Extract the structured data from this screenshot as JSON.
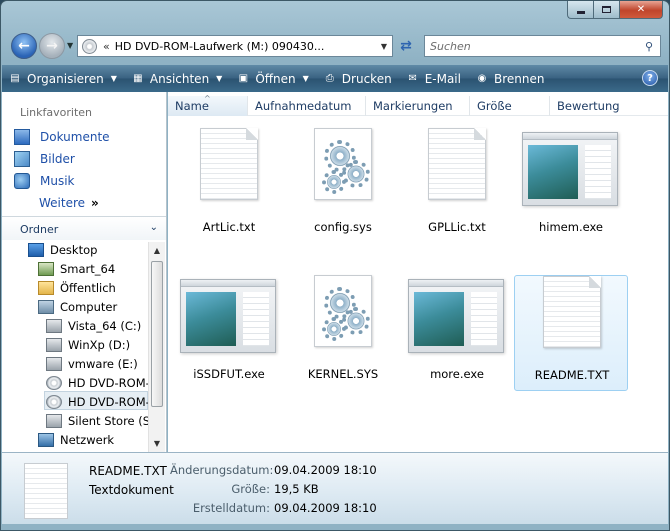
{
  "window": {
    "caption": {
      "minimize": "",
      "maximize": "",
      "close": "✕"
    }
  },
  "nav": {
    "address_path": "HD DVD-ROM-Laufwerk (M:) 090430...",
    "address_chevron": "«",
    "search_placeholder": "Suchen"
  },
  "commands": [
    {
      "label": "Organisieren",
      "icon": "organize-icon",
      "has_dropdown": true
    },
    {
      "label": "Ansichten",
      "icon": "views-icon",
      "has_dropdown": true
    },
    {
      "label": "Öffnen",
      "icon": "open-icon",
      "has_dropdown": true
    },
    {
      "label": "Drucken",
      "icon": "print-icon",
      "has_dropdown": false
    },
    {
      "label": "E-Mail",
      "icon": "email-icon",
      "has_dropdown": false
    },
    {
      "label": "Brennen",
      "icon": "burn-icon",
      "has_dropdown": false
    }
  ],
  "favorites": {
    "title": "Linkfavoriten",
    "items": [
      {
        "label": "Dokumente",
        "icon": "documents-icon"
      },
      {
        "label": "Bilder",
        "icon": "pictures-icon"
      },
      {
        "label": "Musik",
        "icon": "music-icon"
      }
    ],
    "more_label": "Weitere"
  },
  "folders": {
    "title": "Ordner",
    "tree": [
      {
        "label": "Desktop",
        "icon": "desktop-icon",
        "level": 0
      },
      {
        "label": "Smart_64",
        "icon": "user-folder-icon",
        "level": 1
      },
      {
        "label": "Öffentlich",
        "icon": "folder-icon",
        "level": 1
      },
      {
        "label": "Computer",
        "icon": "computer-icon",
        "level": 1
      },
      {
        "label": "Vista_64 (C:)",
        "icon": "drive-icon",
        "level": 2
      },
      {
        "label": "WinXp (D:)",
        "icon": "drive-icon",
        "level": 2
      },
      {
        "label": "vmware (E:)",
        "icon": "drive-icon",
        "level": 2
      },
      {
        "label": "HD DVD-ROM-",
        "icon": "dvd-icon",
        "level": 2
      },
      {
        "label": "HD DVD-ROM-",
        "icon": "dvd-icon",
        "level": 2,
        "selected": true
      },
      {
        "label": "Silent Store (S:)",
        "icon": "drive-icon",
        "level": 2
      },
      {
        "label": "Netzwerk",
        "icon": "network-icon",
        "level": 1
      }
    ]
  },
  "columns": [
    "Name",
    "Aufnahmedatum",
    "Markierungen",
    "Größe",
    "Bewertung"
  ],
  "files": [
    {
      "name": "ArtLic.txt",
      "kind": "txt"
    },
    {
      "name": "config.sys",
      "kind": "sys"
    },
    {
      "name": "GPLLic.txt",
      "kind": "txt"
    },
    {
      "name": "himem.exe",
      "kind": "exe"
    },
    {
      "name": "iSSDFUT.exe",
      "kind": "exe"
    },
    {
      "name": "KERNEL.SYS",
      "kind": "sys"
    },
    {
      "name": "more.exe",
      "kind": "exe"
    },
    {
      "name": "README.TXT",
      "kind": "txt",
      "selected": true
    }
  ],
  "details": {
    "name": "README.TXT",
    "type": "Textdokument",
    "modified_label": "Änderungsdatum:",
    "modified_value": "09.04.2009 18:10",
    "size_label": "Größe:",
    "size_value": "19,5 KB",
    "created_label": "Erstelldatum:",
    "created_value": "09.04.2009 18:10"
  },
  "colors": {
    "accent": "#1f50a8",
    "cmdbar": "#2b5371",
    "selection": "#dceefb"
  }
}
